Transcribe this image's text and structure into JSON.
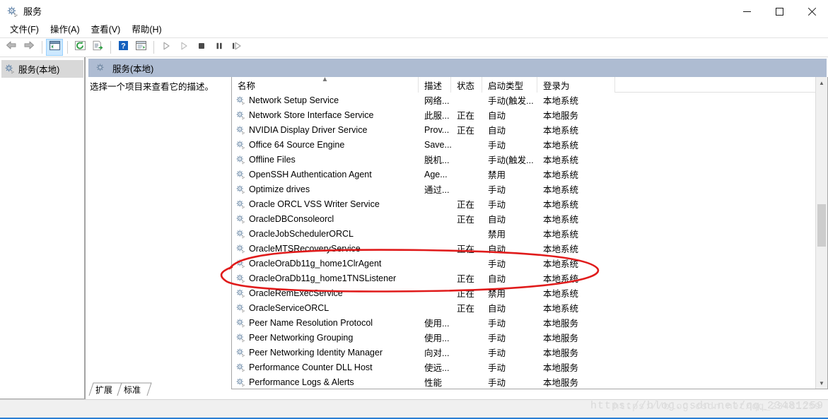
{
  "window": {
    "title": "服务",
    "icon": "services-gear-icon",
    "controls": {
      "minimize": "最小化",
      "maximize": "最大化",
      "close": "关闭"
    }
  },
  "menubar": {
    "items": [
      {
        "label": "文件(F)",
        "name": "menu-file"
      },
      {
        "label": "操作(A)",
        "name": "menu-action"
      },
      {
        "label": "查看(V)",
        "name": "menu-view"
      },
      {
        "label": "帮助(H)",
        "name": "menu-help"
      }
    ]
  },
  "toolbar": {
    "buttons": [
      {
        "name": "back-icon",
        "title": "后退"
      },
      {
        "name": "forward-icon",
        "title": "前进"
      },
      {
        "name": "show-hide-tree-icon",
        "title": "显示/隐藏控制台树",
        "active": true
      },
      {
        "name": "refresh-icon",
        "title": "刷新"
      },
      {
        "name": "export-list-icon",
        "title": "导出列表"
      },
      {
        "name": "help-icon",
        "title": "帮助"
      },
      {
        "name": "properties-icon",
        "title": "属性"
      },
      {
        "name": "start-service-icon",
        "title": "启动服务"
      },
      {
        "name": "resume-service-icon",
        "title": "恢复服务"
      },
      {
        "name": "stop-service-icon",
        "title": "停止服务"
      },
      {
        "name": "pause-service-icon",
        "title": "暂停服务"
      },
      {
        "name": "restart-service-icon",
        "title": "重启服务"
      }
    ]
  },
  "tree": {
    "root_label": "服务(本地)"
  },
  "pane": {
    "header_label": "服务(本地)",
    "description_prompt": "选择一个项目来查看它的描述。"
  },
  "list": {
    "columns": [
      {
        "key": "name",
        "label": "名称",
        "sorted": "asc"
      },
      {
        "key": "desc",
        "label": "描述"
      },
      {
        "key": "status",
        "label": "状态"
      },
      {
        "key": "start",
        "label": "启动类型"
      },
      {
        "key": "logon",
        "label": "登录为"
      }
    ],
    "rows": [
      {
        "name": "Network Setup Service",
        "desc": "网络...",
        "status": "",
        "start": "手动(触发...",
        "logon": "本地系统"
      },
      {
        "name": "Network Store Interface Service",
        "desc": "此服...",
        "status": "正在",
        "start": "自动",
        "logon": "本地服务"
      },
      {
        "name": "NVIDIA Display Driver Service",
        "desc": "Prov...",
        "status": "正在",
        "start": "自动",
        "logon": "本地系统"
      },
      {
        "name": "Office 64 Source Engine",
        "desc": "Save...",
        "status": "",
        "start": "手动",
        "logon": "本地系统"
      },
      {
        "name": "Offline Files",
        "desc": "脱机...",
        "status": "",
        "start": "手动(触发...",
        "logon": "本地系统"
      },
      {
        "name": "OpenSSH Authentication Agent",
        "desc": "Age...",
        "status": "",
        "start": "禁用",
        "logon": "本地系统"
      },
      {
        "name": "Optimize drives",
        "desc": "通过...",
        "status": "",
        "start": "手动",
        "logon": "本地系统"
      },
      {
        "name": "Oracle ORCL VSS Writer Service",
        "desc": "",
        "status": "正在",
        "start": "手动",
        "logon": "本地系统"
      },
      {
        "name": "OracleDBConsoleorcl",
        "desc": "",
        "status": "正在",
        "start": "自动",
        "logon": "本地系统"
      },
      {
        "name": "OracleJobSchedulerORCL",
        "desc": "",
        "status": "",
        "start": "禁用",
        "logon": "本地系统"
      },
      {
        "name": "OracleMTSRecoveryService",
        "desc": "",
        "status": "正在",
        "start": "自动",
        "logon": "本地系统"
      },
      {
        "name": "OracleOraDb11g_home1ClrAgent",
        "desc": "",
        "status": "",
        "start": "手动",
        "logon": "本地系统"
      },
      {
        "name": "OracleOraDb11g_home1TNSListener",
        "desc": "",
        "status": "正在",
        "start": "自动",
        "logon": "本地系统"
      },
      {
        "name": "OracleRemExecService",
        "desc": "",
        "status": "正在",
        "start": "禁用",
        "logon": "本地系统"
      },
      {
        "name": "OracleServiceORCL",
        "desc": "",
        "status": "正在",
        "start": "自动",
        "logon": "本地系统"
      },
      {
        "name": "Peer Name Resolution Protocol",
        "desc": "使用...",
        "status": "",
        "start": "手动",
        "logon": "本地服务"
      },
      {
        "name": "Peer Networking Grouping",
        "desc": "使用...",
        "status": "",
        "start": "手动",
        "logon": "本地服务"
      },
      {
        "name": "Peer Networking Identity Manager",
        "desc": "向对...",
        "status": "",
        "start": "手动",
        "logon": "本地服务"
      },
      {
        "name": "Performance Counter DLL Host",
        "desc": "使远...",
        "status": "",
        "start": "手动",
        "logon": "本地服务"
      },
      {
        "name": "Performance Logs & Alerts",
        "desc": "性能",
        "status": "",
        "start": "手动",
        "logon": "本地服务"
      }
    ]
  },
  "tabs": [
    {
      "label": "扩展",
      "name": "tab-extended",
      "selected": false
    },
    {
      "label": "标准",
      "name": "tab-standard",
      "selected": true
    }
  ],
  "annotation": {
    "color": "#e01b1b",
    "shape": "ellipse",
    "targets": [
      "OracleOraDb11g_home1ClrAgent",
      "OracleOraDb11g_home1TNSListener"
    ]
  },
  "watermark": {
    "line1": "https://blog.csdn.net/qq_23481259",
    "line2": "https://blog.csdn.net/qq_23481259"
  },
  "colors": {
    "pane_header_bg": "#aebcd2",
    "annotation_red": "#e01b1b",
    "accent_blue": "#2a7fd4",
    "toolbar_active": "#cce8ff"
  }
}
